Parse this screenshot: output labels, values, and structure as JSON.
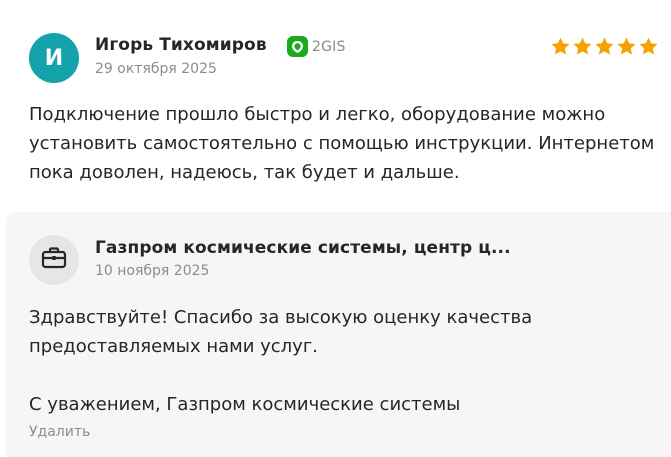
{
  "review": {
    "author_initial": "И",
    "author_name": "Игорь Тихомиров",
    "source": "2GIS",
    "date": "29 октября 2025",
    "rating": 5,
    "text": "Подключение прошло быстро и легко, оборудование можно установить самостоятельно с помощью инструкции. Интернетом пока доволен, надеюсь, так будет и дальше."
  },
  "reply": {
    "business_name": "Газпром космические системы, центр ц...",
    "date": "10 ноября 2025",
    "greeting": "Здравствуйте! Спасибо за высокую оценку качества предоставляемых нами услуг.",
    "signature": "С уважением, Газпром космические системы",
    "delete_label": "Удалить"
  },
  "colors": {
    "avatar": "#14a3ab",
    "star": "#f5a100",
    "source_icon": "#19aa1e",
    "reply_background": "#f6f6f6"
  },
  "icons": {
    "source": "2gis-leaf-icon",
    "star": "star-icon",
    "business": "briefcase-icon"
  }
}
